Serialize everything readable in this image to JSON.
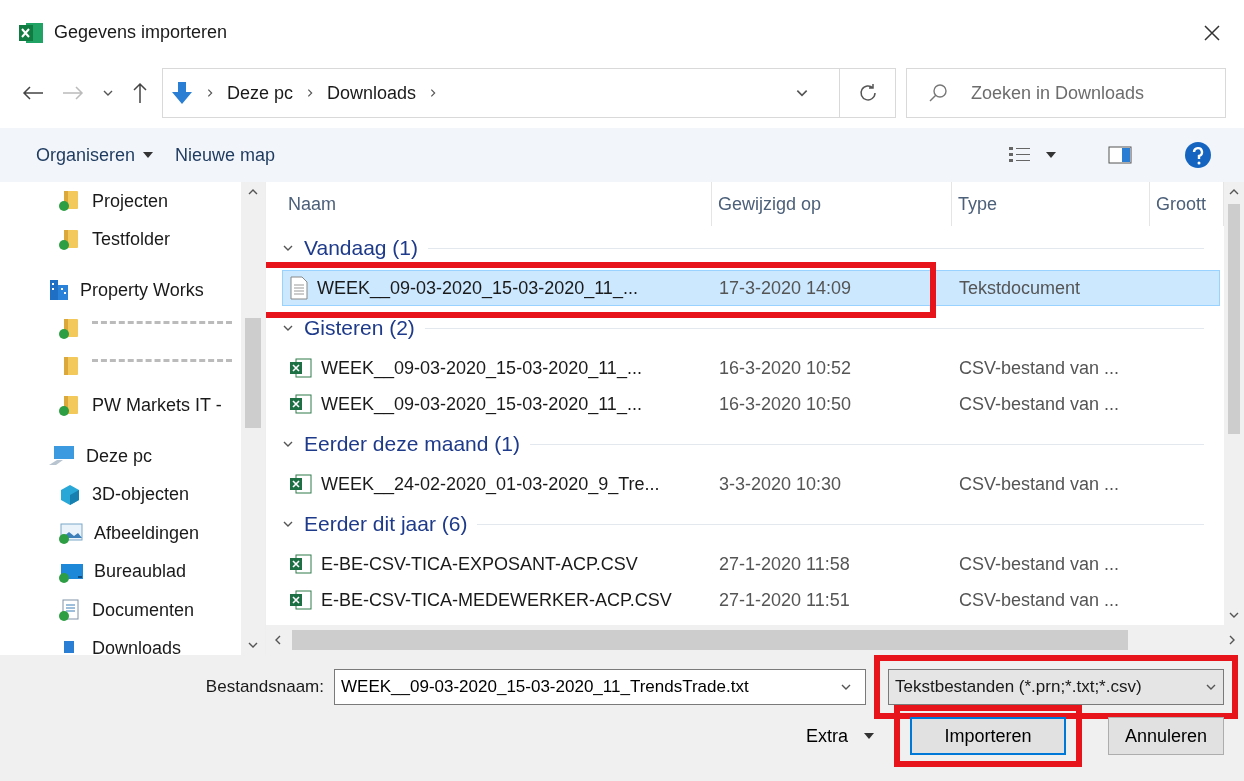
{
  "window": {
    "title": "Gegevens importeren"
  },
  "address": {
    "path": [
      {
        "label": "Deze pc"
      },
      {
        "label": "Downloads"
      }
    ],
    "search_placeholder": "Zoeken in Downloads"
  },
  "toolbar": {
    "organize": "Organiseren",
    "new_folder": "Nieuwe map"
  },
  "sidebar": {
    "items": [
      {
        "kind": "folder",
        "label": "Projecten",
        "synced": true
      },
      {
        "kind": "folder",
        "label": "Testfolder",
        "synced": true
      },
      {
        "kind": "org",
        "label": "Property Works"
      },
      {
        "kind": "redacted-folder",
        "synced": true
      },
      {
        "kind": "redacted-folder",
        "synced": false
      },
      {
        "kind": "folder",
        "label": "PW Markets IT -",
        "synced": true
      },
      {
        "kind": "pc",
        "label": "Deze pc"
      },
      {
        "kind": "cube",
        "label": "3D-objecten",
        "synced": false
      },
      {
        "kind": "pictures",
        "label": "Afbeeldingen",
        "synced": true
      },
      {
        "kind": "desktop",
        "label": "Bureaublad",
        "synced": true
      },
      {
        "kind": "documents",
        "label": "Documenten",
        "synced": true
      },
      {
        "kind": "downloads",
        "label": "Downloads"
      }
    ]
  },
  "table": {
    "columns": [
      "Naam",
      "Gewijzigd op",
      "Type",
      "Groott"
    ],
    "groups": [
      {
        "label": "Vandaag (1)",
        "expanded": true,
        "rows": [
          {
            "kind": "text",
            "name": "WEEK__09-03-2020_15-03-2020_11_...",
            "modified": "17-3-2020 14:09",
            "type": "Tekstdocument",
            "selected": true,
            "highlighted": true
          }
        ]
      },
      {
        "label": "Gisteren (2)",
        "expanded": true,
        "rows": [
          {
            "kind": "csv",
            "name": "WEEK__09-03-2020_15-03-2020_11_...",
            "modified": "16-3-2020 10:52",
            "type": "CSV-bestand van ...",
            "selected": false,
            "highlighted": false
          },
          {
            "kind": "csv",
            "name": "WEEK__09-03-2020_15-03-2020_11_...",
            "modified": "16-3-2020 10:50",
            "type": "CSV-bestand van ...",
            "selected": false,
            "highlighted": false
          }
        ]
      },
      {
        "label": "Eerder deze maand (1)",
        "expanded": true,
        "rows": [
          {
            "kind": "csv",
            "name": "WEEK__24-02-2020_01-03-2020_9_Tre...",
            "modified": "3-3-2020 10:30",
            "type": "CSV-bestand van ...",
            "selected": false,
            "highlighted": false
          }
        ]
      },
      {
        "label": "Eerder dit jaar (6)",
        "expanded": true,
        "rows": [
          {
            "kind": "csv",
            "name": "E-BE-CSV-TICA-EXPOSANT-ACP.CSV",
            "modified": "27-1-2020 11:58",
            "type": "CSV-bestand van ...",
            "selected": false,
            "highlighted": false
          },
          {
            "kind": "csv",
            "name": "E-BE-CSV-TICA-MEDEWERKER-ACP.CSV",
            "modified": "27-1-2020 11:51",
            "type": "CSV-bestand van ...",
            "selected": false,
            "highlighted": false
          }
        ]
      }
    ]
  },
  "footer": {
    "filename_label": "Bestandsnaam:",
    "filename": "WEEK__09-03-2020_15-03-2020_11_TrendsTrade.txt",
    "filter": "Tekstbestanden (*.prn;*.txt;*.csv)",
    "filter_highlighted": true,
    "extra": "Extra",
    "buttons": [
      {
        "label": "Importeren",
        "primary": true,
        "highlighted": true
      },
      {
        "label": "Annuleren",
        "primary": false,
        "highlighted": false
      }
    ]
  }
}
